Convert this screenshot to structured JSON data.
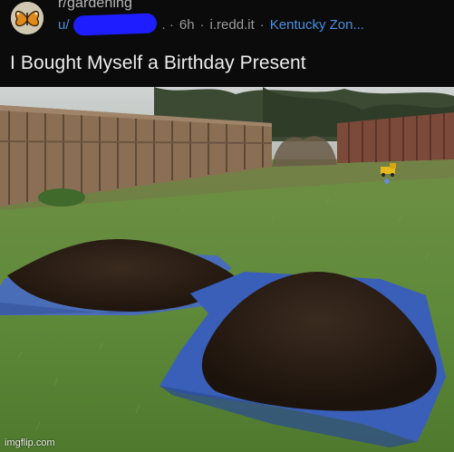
{
  "post": {
    "subreddit": "r/gardening",
    "user_prefix": "u/",
    "time": "6h",
    "domain": "i.redd.it",
    "flair": "Kentucky Zon...",
    "title": "I Bought Myself a Birthday Present"
  },
  "icons": {
    "avatar": "butterfly-avatar-icon"
  },
  "watermark": "imgflip.com",
  "colors": {
    "header_bg": "#0b0b0b",
    "link_blue": "#4a8fe0",
    "redaction_blue": "#1d1dff",
    "tarp_blue": "#3a5fb8",
    "grass": "#5f8a3a"
  }
}
